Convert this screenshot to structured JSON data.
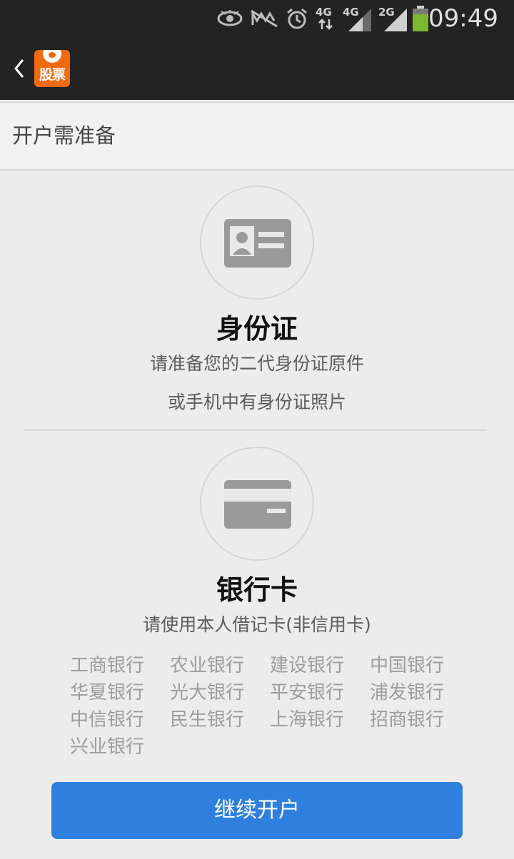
{
  "status_bar": {
    "time": "09:49",
    "network_labels": [
      "4G",
      "4G",
      "2G"
    ],
    "icons": [
      "eye-icon",
      "mute-icon",
      "alarm-icon",
      "data-arrows-icon",
      "signal-icon",
      "signal-icon",
      "signal-icon",
      "battery-icon"
    ],
    "battery_color": "#7cb82f"
  },
  "nav": {
    "logo_text": "股票",
    "logo_color": "#f26a10"
  },
  "header": {
    "title": "开户需准备"
  },
  "id_card": {
    "title": "身份证",
    "line1": "请准备您的二代身份证原件",
    "line2": "或手机中有身份证照片"
  },
  "bank_card": {
    "title": "银行卡",
    "line1": "请使用本人借记卡(非信用卡)",
    "banks": [
      "工商银行",
      "农业银行",
      "建设银行",
      "中国银行",
      "华夏银行",
      "光大银行",
      "平安银行",
      "浦发银行",
      "中信银行",
      "民生银行",
      "上海银行",
      "招商银行",
      "兴业银行"
    ]
  },
  "actions": {
    "continue_label": "继续开户",
    "accent_color": "#2f80de"
  }
}
